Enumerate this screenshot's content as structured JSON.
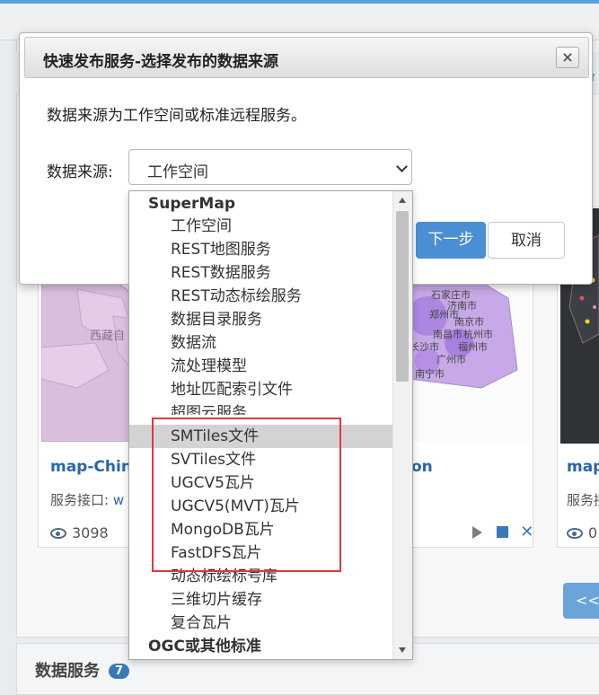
{
  "page": {
    "header_link": "备",
    "pager_label": "<<",
    "bottom_section_title": "数据服务",
    "bottom_section_count": "7"
  },
  "cards": [
    {
      "title": "map-China",
      "sub_prefix": "服务接口: ",
      "sub_link": "w",
      "views": "3098",
      "map_label": "西藏自"
    },
    {
      "title": "on",
      "views": "",
      "cities": [
        "石家庄市",
        "济南市",
        "郑州市",
        "南京市",
        "杭州市",
        "南昌市",
        "长沙市",
        "福州市",
        "广州市",
        "南宁市"
      ]
    },
    {
      "title": "map",
      "sub_prefix": "服务接",
      "views": "0"
    }
  ],
  "modal": {
    "title": "快速发布服务-选择发布的数据来源",
    "close_label": "×",
    "description": "数据来源为工作空间或标准远程服务。",
    "source_label": "数据来源:",
    "selected_source": "工作空间",
    "next_label": "下一步",
    "cancel_label": "取消"
  },
  "dropdown": {
    "groups": [
      "SuperMap",
      "OGC或其他标准"
    ],
    "options": [
      "工作空间",
      "REST地图服务",
      "REST数据服务",
      "REST动态标绘服务",
      "数据目录服务",
      "数据流",
      "流处理模型",
      "地址匹配索引文件",
      "超图云服务",
      "SMTiles文件",
      "SVTiles文件",
      "UGCV5瓦片",
      "UGCV5(MVT)瓦片",
      "MongoDB瓦片",
      "FastDFS瓦片",
      "动态标绘标号库",
      "三维切片缓存",
      "复合瓦片"
    ],
    "highlighted_option": "SMTiles文件"
  },
  "colors": {
    "primary": "#4a8fd4",
    "highlight_border": "#e0383e",
    "link": "#2a64b0"
  }
}
